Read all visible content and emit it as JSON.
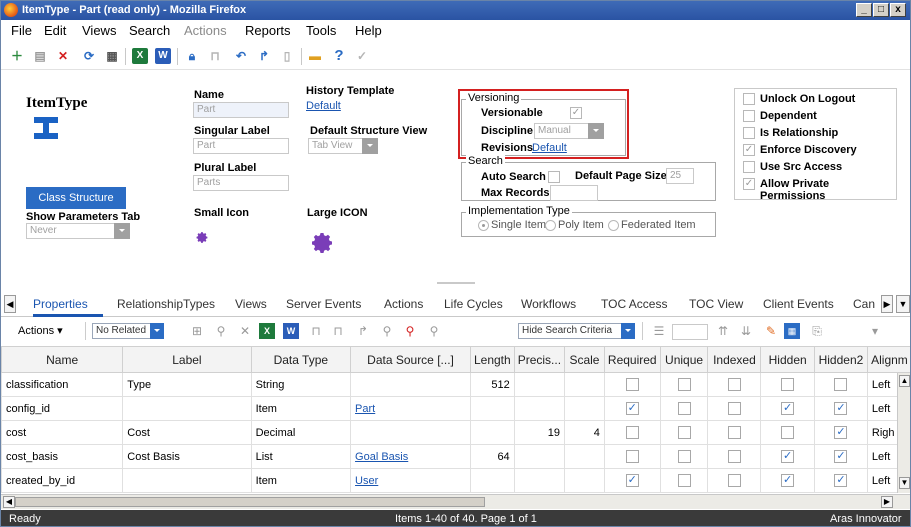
{
  "window": {
    "title": "ItemType - Part (read only) - Mozilla Firefox",
    "min": "_",
    "max": "□",
    "close": "x"
  },
  "menu": [
    "File",
    "Edit",
    "Views",
    "Search",
    "Actions",
    "Reports",
    "Tools",
    "Help"
  ],
  "form": {
    "header": "ItemType",
    "name_label": "Name",
    "name_value": "Part",
    "singular_label": "Singular Label",
    "singular_value": "Part",
    "plural_label": "Plural Label",
    "plural_value": "Parts",
    "small_icon_label": "Small Icon",
    "large_icon_label": "Large ICON",
    "history_template_label": "History Template",
    "history_template_link": "Default",
    "default_structure_view_label": "Default Structure View",
    "default_structure_view_value": "Tab View",
    "class_structure_button": "Class Structure",
    "show_parameters_tab_label": "Show Parameters Tab",
    "show_parameters_tab_value": "Never",
    "versioning": {
      "legend": "Versioning",
      "versionable_label": "Versionable",
      "discipline_label": "Discipline",
      "discipline_value": "Manual",
      "revisions_label": "Revisions",
      "revisions_link": "Default"
    },
    "search": {
      "legend": "Search",
      "auto_search_label": "Auto Search",
      "default_page_size_label": "Default Page Size",
      "default_page_size_value": "25",
      "max_records_label": "Max Records",
      "max_records_value": ""
    },
    "implementation": {
      "legend": "Implementation Type",
      "options": [
        "Single Item",
        "Poly Item",
        "Federated Item"
      ]
    },
    "flags": [
      {
        "label": "Unlock On Logout",
        "checked": false
      },
      {
        "label": "Dependent",
        "checked": false
      },
      {
        "label": "Is Relationship",
        "checked": false
      },
      {
        "label": "Enforce Discovery",
        "checked": true
      },
      {
        "label": "Use Src Access",
        "checked": false
      },
      {
        "label": "Allow Private Permissions",
        "checked": true
      }
    ]
  },
  "tabs": [
    "Properties",
    "RelationshipTypes",
    "Views",
    "Server Events",
    "Actions",
    "Life Cycles",
    "Workflows",
    "TOC Access",
    "TOC View",
    "Client Events",
    "Can"
  ],
  "gridbar": {
    "actions_label": "Actions",
    "related_value": "No Related",
    "search_criteria_value": "Hide Search Criteria"
  },
  "grid": {
    "columns": [
      "Name",
      "Label",
      "Data Type",
      "Data Source [...]",
      "Length",
      "Precis...",
      "Scale",
      "Required",
      "Unique",
      "Indexed",
      "Hidden",
      "Hidden2",
      "Alignm"
    ],
    "rows": [
      {
        "name": "classification",
        "label": "Type",
        "type": "String",
        "source": "",
        "length": "512",
        "precision": "",
        "scale": "",
        "required": false,
        "unique": false,
        "indexed": false,
        "hidden": false,
        "hidden2": false,
        "align": "Left"
      },
      {
        "name": "config_id",
        "label": "",
        "type": "Item",
        "source": "Part",
        "length": "",
        "precision": "",
        "scale": "",
        "required": true,
        "unique": false,
        "indexed": false,
        "hidden": true,
        "hidden2": true,
        "align": "Left"
      },
      {
        "name": "cost",
        "label": "Cost",
        "type": "Decimal",
        "source": "",
        "length": "",
        "precision": "19",
        "scale": "4",
        "required": false,
        "unique": false,
        "indexed": false,
        "hidden": false,
        "hidden2": true,
        "align": "Righ"
      },
      {
        "name": "cost_basis",
        "label": "Cost Basis",
        "type": "List",
        "source": "Goal Basis",
        "length": "64",
        "precision": "",
        "scale": "",
        "required": false,
        "unique": false,
        "indexed": false,
        "hidden": true,
        "hidden2": true,
        "align": "Left"
      },
      {
        "name": "created_by_id",
        "label": "",
        "type": "Item",
        "source": "User",
        "length": "",
        "precision": "",
        "scale": "",
        "required": true,
        "unique": false,
        "indexed": false,
        "hidden": true,
        "hidden2": true,
        "align": "Left"
      }
    ]
  },
  "status": {
    "left": "Ready",
    "center": "Items 1-40 of 40. Page 1 of 1",
    "right": "Aras Innovator"
  },
  "colors": {
    "accent": "#1a55b0",
    "title_bar": "#2a53a3",
    "highlight_box": "#d42020",
    "status_bar": "#3a3a3a"
  }
}
